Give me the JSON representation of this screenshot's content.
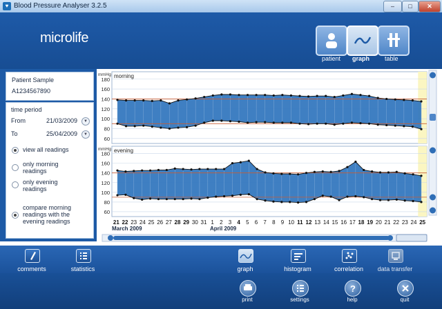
{
  "window": {
    "title": "Blood Pressure Analyser 3.2.5",
    "minimize": "–",
    "maximize": "□",
    "close": "✕"
  },
  "brand": {
    "logo": "microlife"
  },
  "views": [
    {
      "label": "patient",
      "icon": "patient-icon"
    },
    {
      "label": "graph",
      "icon": "graph-icon",
      "active": true
    },
    {
      "label": "table",
      "icon": "table-icon"
    }
  ],
  "patient": {
    "name": "Patient Sample",
    "id": "A1234567890"
  },
  "period": {
    "heading": "time period",
    "from_label": "From",
    "from_value": "21/03/2009",
    "to_label": "To",
    "to_value": "25/04/2009"
  },
  "filters": [
    {
      "label": "view all readings",
      "selected": true
    },
    {
      "label": "only morning readings",
      "selected": false
    },
    {
      "label": "only evening readings",
      "selected": false
    },
    {
      "label": "compare morning readings with the evening readings",
      "selected": true
    }
  ],
  "chart_data": [
    {
      "type": "area",
      "title": "morning",
      "ylabel": "mmHg",
      "yticks": [
        60,
        80,
        100,
        120,
        140,
        160,
        180
      ],
      "ylim": [
        50,
        195
      ],
      "x": [
        "21",
        "22",
        "23",
        "24",
        "25",
        "26",
        "27",
        "28",
        "29",
        "30",
        "31",
        "1",
        "2",
        "3",
        "4",
        "5",
        "6",
        "7",
        "8",
        "9",
        "10",
        "11",
        "12",
        "13",
        "14",
        "15",
        "16",
        "17",
        "18",
        "19",
        "20",
        "21",
        "22",
        "23",
        "24",
        "25"
      ],
      "series": [
        {
          "name": "",
          "values": [
            138,
            137,
            137,
            137,
            136,
            137,
            131,
            137,
            139,
            141,
            144,
            147,
            149,
            149,
            148,
            148,
            148,
            148,
            147,
            148,
            147,
            146,
            145,
            146,
            146,
            144,
            147,
            150,
            148,
            146,
            142,
            140,
            139,
            138,
            137,
            135
          ]
        },
        {
          "name": "",
          "values": [
            90,
            85,
            85,
            86,
            84,
            82,
            80,
            82,
            83,
            86,
            92,
            96,
            96,
            95,
            94,
            92,
            93,
            93,
            92,
            92,
            92,
            90,
            89,
            90,
            90,
            88,
            90,
            92,
            91,
            90,
            88,
            87,
            86,
            85,
            84,
            79
          ]
        }
      ],
      "reference_lines": [
        140,
        90
      ]
    },
    {
      "type": "area",
      "title": "evening",
      "ylabel": "mmHg",
      "yticks": [
        60,
        80,
        100,
        120,
        140,
        160,
        180
      ],
      "ylim": [
        50,
        195
      ],
      "x": [
        "21",
        "22",
        "23",
        "24",
        "25",
        "26",
        "27",
        "28",
        "29",
        "30",
        "31",
        "1",
        "2",
        "3",
        "4",
        "5",
        "6",
        "7",
        "8",
        "9",
        "10",
        "11",
        "12",
        "13",
        "14",
        "15",
        "16",
        "17",
        "18",
        "19",
        "20",
        "21",
        "22",
        "23",
        "24",
        "25"
      ],
      "series": [
        {
          "name": "",
          "values": [
            145,
            143,
            144,
            145,
            145,
            146,
            146,
            149,
            148,
            147,
            148,
            148,
            148,
            148,
            160,
            162,
            165,
            148,
            141,
            139,
            138,
            138,
            137,
            140,
            142,
            143,
            142,
            144,
            152,
            163,
            146,
            143,
            141,
            141,
            142,
            139,
            137,
            134
          ]
        },
        {
          "name": "",
          "values": [
            94,
            95,
            88,
            85,
            87,
            86,
            86,
            86,
            86,
            87,
            86,
            89,
            91,
            92,
            93,
            95,
            96,
            86,
            83,
            81,
            80,
            80,
            79,
            80,
            86,
            93,
            91,
            84,
            91,
            92,
            90,
            86,
            84,
            84,
            85,
            83,
            82,
            80
          ]
        }
      ],
      "reference_lines": [
        140,
        90
      ]
    }
  ],
  "xaxis": {
    "days": [
      {
        "d": "21",
        "b": true
      },
      {
        "d": "22",
        "b": true
      },
      {
        "d": "23",
        "b": false
      },
      {
        "d": "24",
        "b": false
      },
      {
        "d": "25",
        "b": false
      },
      {
        "d": "26",
        "b": false
      },
      {
        "d": "27",
        "b": false
      },
      {
        "d": "28",
        "b": true
      },
      {
        "d": "29",
        "b": true
      },
      {
        "d": "30",
        "b": false
      },
      {
        "d": "31",
        "b": false
      },
      {
        "d": "1",
        "b": false
      },
      {
        "d": "2",
        "b": false
      },
      {
        "d": "3",
        "b": false
      },
      {
        "d": "4",
        "b": true
      },
      {
        "d": "5",
        "b": false
      },
      {
        "d": "6",
        "b": false
      },
      {
        "d": "7",
        "b": false
      },
      {
        "d": "8",
        "b": false
      },
      {
        "d": "9",
        "b": false
      },
      {
        "d": "10",
        "b": false
      },
      {
        "d": "11",
        "b": true
      },
      {
        "d": "12",
        "b": true
      },
      {
        "d": "13",
        "b": false
      },
      {
        "d": "14",
        "b": false
      },
      {
        "d": "15",
        "b": false
      },
      {
        "d": "16",
        "b": false
      },
      {
        "d": "17",
        "b": false
      },
      {
        "d": "18",
        "b": true
      },
      {
        "d": "19",
        "b": true
      },
      {
        "d": "20",
        "b": false
      },
      {
        "d": "21",
        "b": false
      },
      {
        "d": "22",
        "b": false
      },
      {
        "d": "23",
        "b": false
      },
      {
        "d": "24",
        "b": false
      },
      {
        "d": "25",
        "b": true
      }
    ],
    "month1": "March 2009",
    "month2": "April 2009"
  },
  "toolbar": [
    {
      "label": "comments",
      "icon": "pencil-icon"
    },
    {
      "label": "statistics",
      "icon": "statistics-icon"
    },
    {
      "label": "graph",
      "icon": "graph-icon"
    },
    {
      "label": "histogram",
      "icon": "histogram-icon"
    },
    {
      "label": "correlation",
      "icon": "correlation-icon"
    },
    {
      "label": "data transfer",
      "icon": "data-transfer-icon"
    }
  ],
  "bottom": [
    {
      "label": "print",
      "icon": "print-icon"
    },
    {
      "label": "settings",
      "icon": "settings-icon"
    },
    {
      "label": "help",
      "icon": "help-icon"
    },
    {
      "label": "quit",
      "icon": "quit-icon"
    }
  ],
  "colors": {
    "band": "#2f74bd",
    "highlight": "#fbf6c2",
    "ref_line": "#c95d33",
    "grid": "#c9d7ea"
  }
}
